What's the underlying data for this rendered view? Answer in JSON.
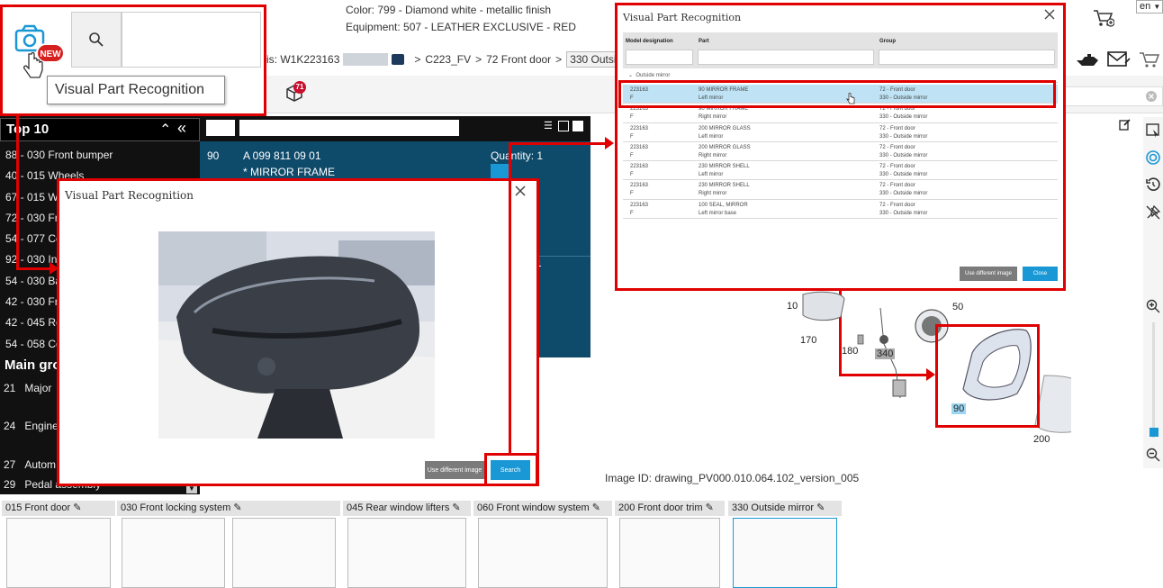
{
  "header": {
    "color_line": "Color: 799 - Diamond white - metallic finish",
    "equipment_line": "Equipment: 507 - LEATHER EXCLUSIVE - RED",
    "language": "en"
  },
  "breadcrumb": {
    "chassis_label": "sis: W1K223163",
    "sep1": ">",
    "item1": "C223_FV",
    "sep2": ">",
    "item2": "72 Front door",
    "sep3": ">",
    "item3": "330 Outsi"
  },
  "badges": {
    "new_label": "NEW",
    "cart_count": "71"
  },
  "tooltip": {
    "text": "Visual Part Recognition"
  },
  "top10": {
    "title": "Top 10",
    "items": [
      "88 - 030 Front bumper",
      "40 - 015 Wheels",
      "67 - 015 Wi",
      "72 - 030 Fr",
      "54 - 077 Co",
      "92 - 030 In",
      "54 - 030 Ba",
      "42 - 030 Fr",
      "42 - 045 Re",
      "54 - 058 Co"
    ]
  },
  "main_groups": {
    "title": "Main gro",
    "items": [
      {
        "num": "21",
        "label": "Major"
      },
      {
        "num": "24",
        "label": "Engine"
      },
      {
        "num": "27",
        "label": "Autom"
      },
      {
        "num": "29",
        "label": "Pedal assembly"
      }
    ]
  },
  "part_panel": {
    "pos": "90",
    "part_number": "A 099 811 09 01",
    "part_name": "* MIRROR FRAME",
    "quantity": "Quantity: 1",
    "second_quantity": "1"
  },
  "vpr_left": {
    "title": "Visual Part Recognition",
    "btn_different": "Use different image",
    "btn_search": "Search"
  },
  "vpr_right": {
    "title": "Visual Part Recognition",
    "columns": [
      "Model designation",
      "Part",
      "Group"
    ],
    "group_label": "Outside mirror",
    "rows": [
      {
        "model1": "223163",
        "model2": "F",
        "part1": "90 MIRROR FRAME",
        "part2": "Left mirror",
        "group1": "72 - Front door",
        "group2": "330 - Outside mirror"
      },
      {
        "model1": "223163",
        "model2": "F",
        "part1": "90 MIRROR FRAME",
        "part2": "Right mirror",
        "group1": "72 - Front door",
        "group2": "330 - Outside mirror"
      },
      {
        "model1": "223163",
        "model2": "F",
        "part1": "200 MIRROR GLASS",
        "part2": "Left mirror",
        "group1": "72 - Front door",
        "group2": "330 - Outside mirror"
      },
      {
        "model1": "223163",
        "model2": "F",
        "part1": "200 MIRROR GLASS",
        "part2": "Right mirror",
        "group1": "72 - Front door",
        "group2": "330 - Outside mirror"
      },
      {
        "model1": "223163",
        "model2": "F",
        "part1": "230 MIRROR SHELL",
        "part2": "Left mirror",
        "group1": "72 - Front door",
        "group2": "330 - Outside mirror"
      },
      {
        "model1": "223163",
        "model2": "F",
        "part1": "230 MIRROR SHELL",
        "part2": "Right mirror",
        "group1": "72 - Front door",
        "group2": "330 - Outside mirror"
      },
      {
        "model1": "223163",
        "model2": "F",
        "part1": "100 SEAL, MIRROR",
        "part2": "Left mirror base",
        "group1": "72 - Front door",
        "group2": "330 - Outside mirror"
      }
    ],
    "btn_different": "Use different image",
    "btn_close": "Close"
  },
  "drawing": {
    "labels": [
      "10",
      "50",
      "170",
      "180",
      "340",
      "90",
      "200"
    ],
    "image_id": "Image ID: drawing_PV000.010.064.102_version_005"
  },
  "thumbnails": [
    "015 Front door",
    "030 Front locking system",
    "045 Rear window lifters",
    "060 Front window system",
    "200 Front door trim",
    "330 Outside mirror"
  ],
  "icons": {
    "camera": "camera-icon",
    "search": "search-icon",
    "cart": "cart-icon",
    "mail": "mail-icon",
    "oil": "oil-can-icon"
  }
}
